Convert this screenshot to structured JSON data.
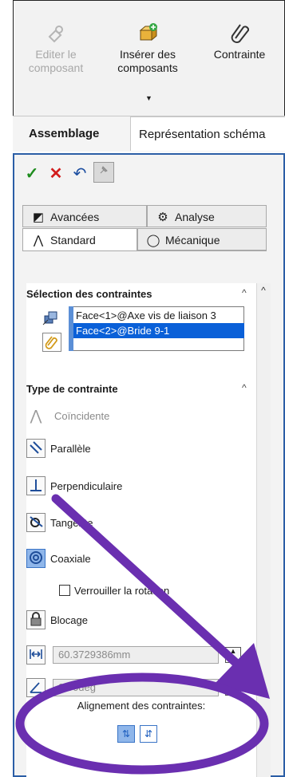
{
  "ribbon": {
    "edit_component_line1": "Editer le",
    "edit_component_line2": "composant",
    "insert_components_line1": "Insérer des",
    "insert_components_line2": "composants",
    "mate_label": "Contrainte",
    "dropdown_glyph": "▼",
    "tabs": [
      {
        "label": "Assemblage"
      },
      {
        "label": "Représentation schéma"
      }
    ]
  },
  "panel": {
    "ok_glyph": "✓",
    "cancel_glyph": "✕",
    "undo_glyph": "↶",
    "pin_glyph": "📌",
    "tabs": [
      {
        "label": "Avancées",
        "icon": "advanced-mates-icon"
      },
      {
        "label": "Analyse",
        "icon": "analysis-gear-icon"
      },
      {
        "label": "Standard",
        "icon": "standard-mates-icon"
      },
      {
        "label": "Mécanique",
        "icon": "mechanical-mates-icon"
      }
    ],
    "selection_group": {
      "title": "Sélection des contraintes",
      "collapse_glyph": "^",
      "items": [
        "Face<1>@Axe vis de liaison 3",
        "Face<2>@Bride 9-1"
      ]
    },
    "mate_type_group": {
      "title": "Type de contrainte",
      "collapse_glyph": "^",
      "coincident": "Coïncidente",
      "parallel": "Parallèle",
      "perpendicular": "Perpendiculaire",
      "tangent": "Tangente",
      "concentric": "Coaxiale",
      "lock_rotation": "Verrouiller la rotation",
      "lock": "Blocage",
      "distance_value": "60.3729386mm",
      "angle_value": "0.00deg"
    },
    "alignment": {
      "title": "Alignement des contraintes:",
      "aligned_glyph": "⇅",
      "anti_aligned_glyph": "⇵"
    },
    "scroll_up_glyph": "^"
  },
  "colors": {
    "accent_blue": "#2b5ea6",
    "selection_blue": "#0a60d8",
    "annotation_purple": "#6a2fb0",
    "ok_green": "#1e8c1e",
    "cancel_red": "#d21d1d"
  }
}
